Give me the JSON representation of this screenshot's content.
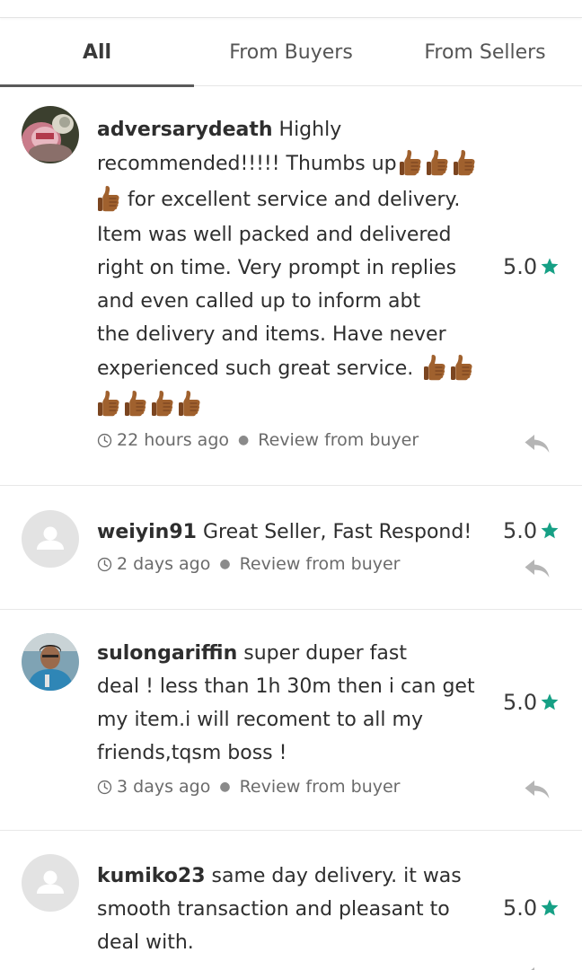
{
  "tabs": [
    {
      "label": "All"
    },
    {
      "label": "From Buyers"
    },
    {
      "label": "From Sellers"
    }
  ],
  "reviews": [
    {
      "username": "adversarydeath",
      "line1": "Highly",
      "line2": "recommended!!!!! Thumbs up",
      "line3": "for excellent service and delivery.",
      "line4": "Item was well packed and delivered",
      "line5": "right on time. Very prompt in replies",
      "line6": "and even called up to inform abt",
      "line7": "the delivery and items. Have never",
      "line8": "experienced such great service.",
      "time": "22 hours ago",
      "source": "Review from buyer",
      "rating": "5.0"
    },
    {
      "username": "weiyin91",
      "comment": "Great Seller, Fast Respond!",
      "time": "2 days ago",
      "source": "Review from buyer",
      "rating": "5.0"
    },
    {
      "username": "sulongariffin",
      "line1": "super duper fast",
      "line2": "deal ! less than 1h 30m then i can get",
      "line3": "my item.i will recoment to all my",
      "line4": "friends,tqsm boss !",
      "time": "3 days ago",
      "source": "Review from buyer",
      "rating": "5.0"
    },
    {
      "username": "kumiko23",
      "line1": "same day delivery. it was",
      "line2": "smooth transaction and pleasant to",
      "line3": "deal with.",
      "rating": "5.0"
    }
  ],
  "colors": {
    "star": "#16a085",
    "thumb": "#a0612e",
    "active_tab_underline": "#5a5a5a",
    "icon_gray": "#b5b5b5"
  },
  "icons": {
    "thumb": "thumbs-up-emoji-icon",
    "clock": "clock-icon",
    "star": "star-icon",
    "reply": "reply-icon",
    "avatar": "user-avatar-icon"
  }
}
